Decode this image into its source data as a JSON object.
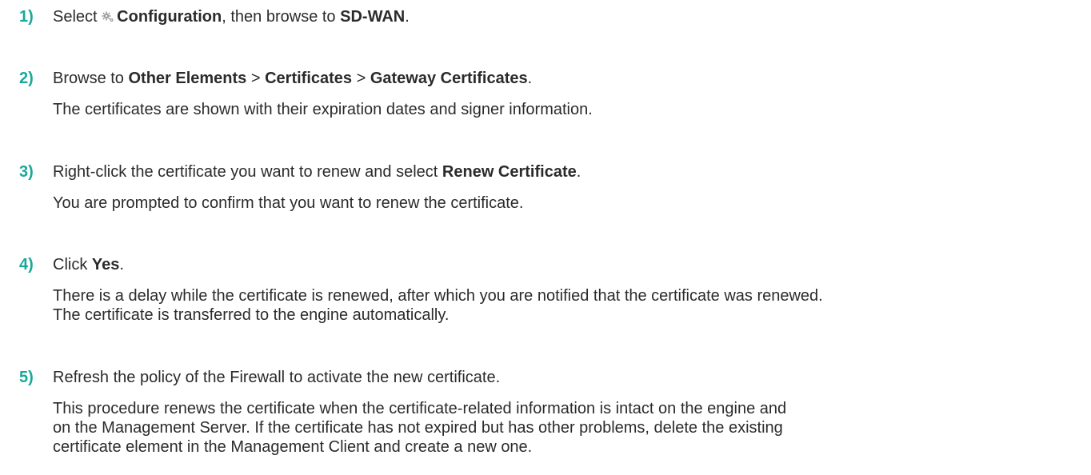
{
  "step1": {
    "num": "1)",
    "t1": "Select ",
    "icon": "gear-icon",
    "b1": "Configuration",
    "t2": ", then browse to ",
    "b2": "SD-WAN",
    "t3": "."
  },
  "step2": {
    "num": "2)",
    "t1": "Browse to ",
    "b1": "Other Elements",
    "t2": " > ",
    "b2": "Certificates",
    "t3": " > ",
    "b3": "Gateway Certificates",
    "t4": ".",
    "result": "The certificates are shown with their expiration dates and signer information."
  },
  "step3": {
    "num": "3)",
    "t1": "Right-click the certificate you want to renew and select ",
    "b1": "Renew Certificate",
    "t2": ".",
    "result": "You are prompted to confirm that you want to renew the certificate."
  },
  "step4": {
    "num": "4)",
    "t1": "Click ",
    "b1": "Yes",
    "t2": ".",
    "result_line1": "There is a delay while the certificate is renewed, after which you are notified that the certificate was renewed.",
    "result_line2": "The certificate is transferred to the engine automatically."
  },
  "step5": {
    "num": "5)",
    "text": "Refresh the policy of the Firewall to activate the new certificate.",
    "note_line1": "This procedure renews the certificate when the certificate-related information is intact on the engine and",
    "note_line2": "on the Management Server. If the certificate has not expired but has other problems, delete the existing",
    "note_line3": "certificate element in the Management Client and create a new one."
  },
  "colors": {
    "step_number": "#18a99a",
    "text": "#2b2b2b",
    "icon": "#9a9a9a"
  }
}
